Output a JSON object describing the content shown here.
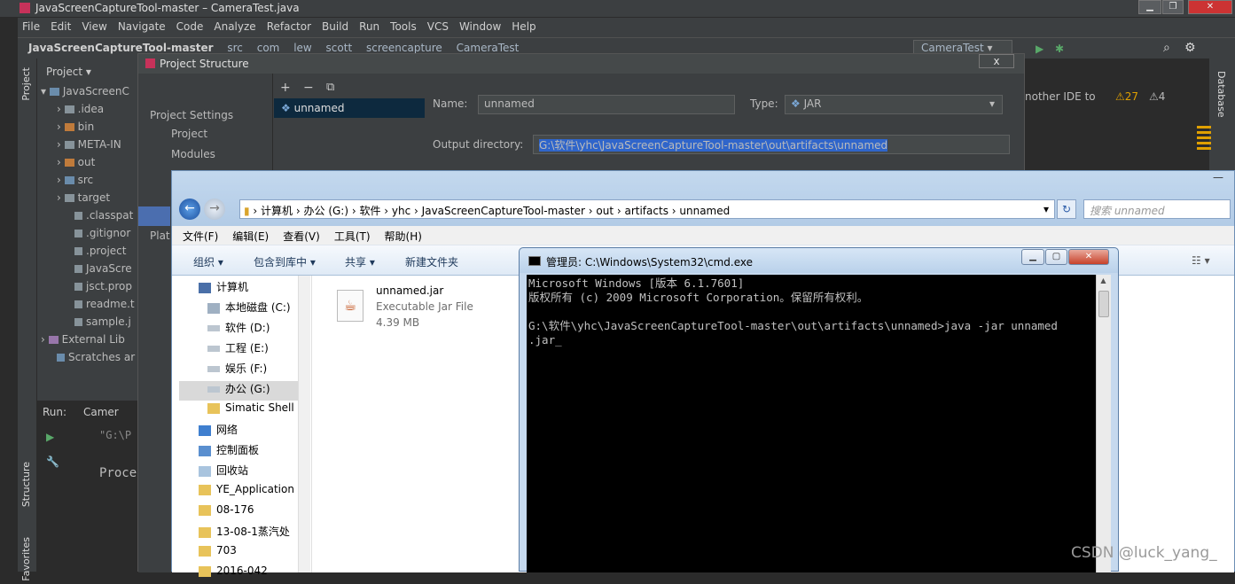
{
  "ide": {
    "window_title": "JavaScreenCaptureTool-master – CameraTest.java",
    "menu": [
      "File",
      "Edit",
      "View",
      "Navigate",
      "Code",
      "Analyze",
      "Refactor",
      "Build",
      "Run",
      "Tools",
      "VCS",
      "Window",
      "Help"
    ],
    "breadcrumb": [
      "JavaScreenCaptureTool-master",
      "src",
      "com",
      "lew",
      "scott",
      "screencapture",
      "CameraTest"
    ],
    "run_config": "CameraTest",
    "left_tool_windows": [
      "Project",
      "Structure",
      "Favorites"
    ],
    "right_tool_windows": [
      "Database"
    ],
    "project_panel": {
      "header": "Project",
      "items": [
        {
          "label": "JavaScreenC",
          "icon": "module-folder-icon"
        },
        {
          "label": ".idea",
          "icon": "folder-icon"
        },
        {
          "label": "bin",
          "icon": "excluded-folder-icon"
        },
        {
          "label": "META-IN",
          "icon": "folder-icon"
        },
        {
          "label": "out",
          "icon": "excluded-folder-icon"
        },
        {
          "label": "src",
          "icon": "source-folder-icon"
        },
        {
          "label": "target",
          "icon": "folder-icon"
        },
        {
          "label": ".classpat",
          "icon": "file-icon"
        },
        {
          "label": ".gitignor",
          "icon": "file-icon"
        },
        {
          "label": ".project",
          "icon": "file-icon"
        },
        {
          "label": "JavaScre",
          "icon": "file-icon"
        },
        {
          "label": "jsct.prop",
          "icon": "file-icon"
        },
        {
          "label": "readme.t",
          "icon": "file-icon"
        },
        {
          "label": "sample.j",
          "icon": "file-icon"
        },
        {
          "label": "External Lib",
          "icon": "library-icon"
        },
        {
          "label": "Scratches ar",
          "icon": "scratch-icon"
        }
      ]
    },
    "run_panel": {
      "label": "Run:",
      "tab": "Camer",
      "line1": "\"G:\\P",
      "line2": "Proce"
    },
    "inspections": {
      "warnings": "27",
      "weak_warnings": "4",
      "notice": "nother IDE to"
    },
    "help_mark": "?"
  },
  "project_structure": {
    "title": "Project Structure",
    "close": "x",
    "sidebar_header": "Project Settings",
    "sidebar_items": [
      "Project",
      "Modules"
    ],
    "sidebar_partial": "Plat",
    "toolbar": [
      "+",
      "−",
      "⧉"
    ],
    "artifact": "unnamed",
    "name_label": "Name:",
    "name_value": "unnamed",
    "type_label": "Type:",
    "type_value": "JAR",
    "output_label": "Output directory:",
    "output_value": "G:\\软件\\yhc\\JavaScreenCaptureTool-master\\out\\artifacts\\unnamed"
  },
  "explorer": {
    "address": [
      "计算机",
      "办公 (G:)",
      "软件",
      "yhc",
      "JavaScreenCaptureTool-master",
      "out",
      "artifacts",
      "unnamed"
    ],
    "search_placeholder": "搜索 unnamed",
    "menu": [
      "文件(F)",
      "编辑(E)",
      "查看(V)",
      "工具(T)",
      "帮助(H)"
    ],
    "toolbar": [
      "组织 ▾",
      "包含到库中 ▾",
      "共享 ▾",
      "新建文件夹"
    ],
    "nav": [
      {
        "label": "计算机",
        "icon": "computer-icon"
      },
      {
        "label": "本地磁盘 (C:)",
        "icon": "drive-icon"
      },
      {
        "label": "软件 (D:)",
        "icon": "drive-icon"
      },
      {
        "label": "工程 (E:)",
        "icon": "drive-icon"
      },
      {
        "label": "娱乐 (F:)",
        "icon": "drive-icon"
      },
      {
        "label": "办公 (G:)",
        "icon": "drive-icon"
      },
      {
        "label": "Simatic Shell",
        "icon": "folder-icon"
      },
      {
        "label": "网络",
        "icon": "network-icon"
      },
      {
        "label": "控制面板",
        "icon": "control-panel-icon"
      },
      {
        "label": "回收站",
        "icon": "recycle-bin-icon"
      },
      {
        "label": "YE_Application",
        "icon": "folder-icon"
      },
      {
        "label": "08-176",
        "icon": "folder-icon"
      },
      {
        "label": "13-08-1蒸汽处",
        "icon": "folder-icon"
      },
      {
        "label": "703",
        "icon": "folder-icon"
      },
      {
        "label": "2016-042",
        "icon": "folder-icon"
      }
    ],
    "file": {
      "name": "unnamed.jar",
      "type": "Executable Jar File",
      "size": "4.39 MB"
    }
  },
  "cmd": {
    "title": "管理员: C:\\Windows\\System32\\cmd.exe",
    "lines": [
      "Microsoft Windows [版本 6.1.7601]",
      "版权所有 (c) 2009 Microsoft Corporation。保留所有权利。",
      "",
      "G:\\软件\\yhc\\JavaScreenCaptureTool-master\\out\\artifacts\\unnamed>java -jar unnamed",
      ".jar_"
    ]
  },
  "watermark": "CSDN @luck_yang_"
}
